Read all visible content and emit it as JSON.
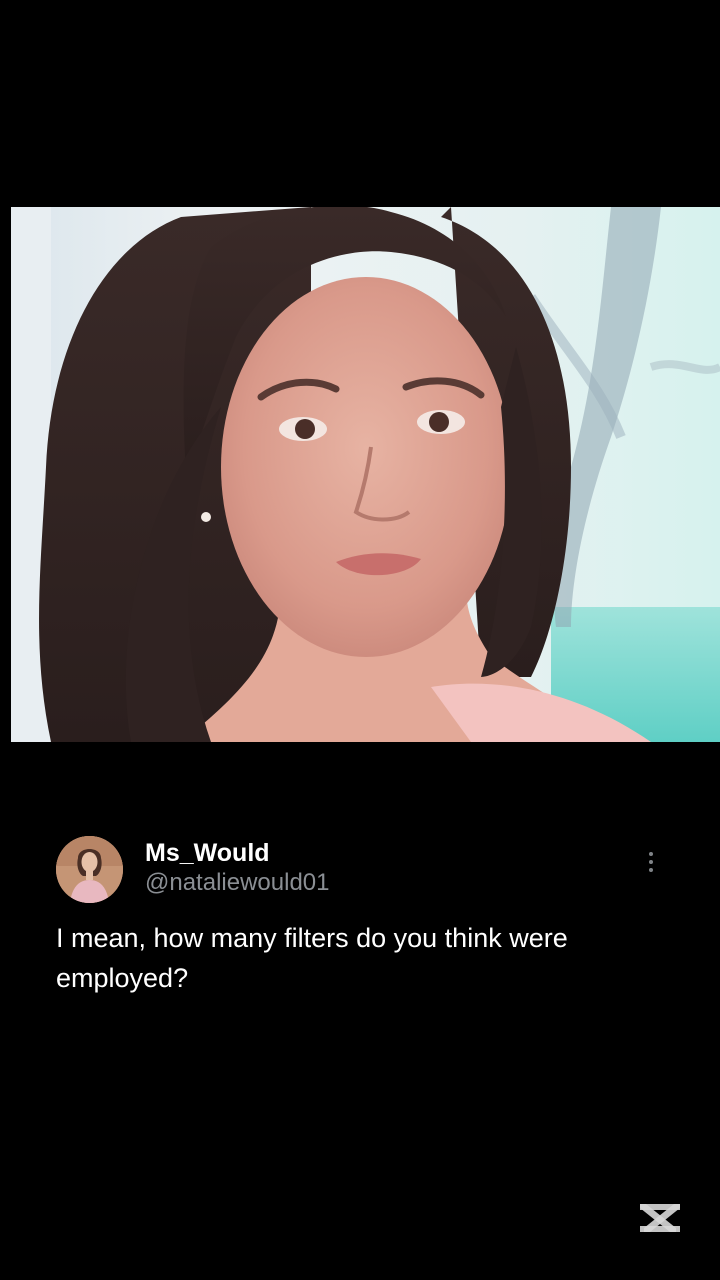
{
  "post": {
    "display_name": "Ms_Would",
    "handle": "@nataliewould01",
    "text": "I mean, how many filters do you think were employed?",
    "avatar_icon": "profile-avatar",
    "more_icon": "more-vertical-icon"
  },
  "video": {
    "frame_icon": "video-still-image"
  },
  "watermark": {
    "icon": "capcut-logo-icon"
  },
  "colors": {
    "background": "#000000",
    "name_text": "#ffffff",
    "handle_text": "#8b8f94",
    "body_text": "#ffffff"
  }
}
